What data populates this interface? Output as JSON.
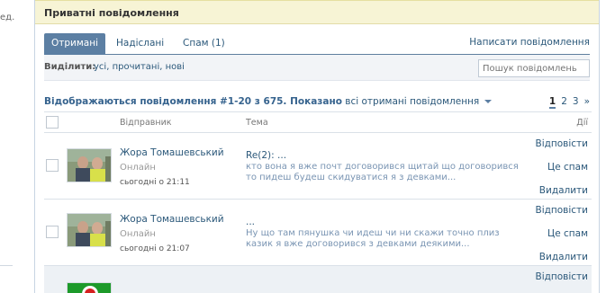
{
  "left_fragment": "ед.",
  "title": "Приватні повідомлення",
  "tabs": [
    "Отримані",
    "Надіслані",
    "Спам (1)"
  ],
  "compose_label": "Написати повідомлення",
  "filter": {
    "label": "Виділити:",
    "links": [
      "усі",
      "прочитані",
      "нові"
    ],
    "search_placeholder": "Пошук повідомлень"
  },
  "summary": {
    "text": "Відображаються повідомлення #1-20 з 675. Показано",
    "dropdown": "всі отримані повідомлення"
  },
  "pager": [
    "1",
    "2",
    "3",
    "»"
  ],
  "columns": {
    "sender": "Відправник",
    "subject": "Тема",
    "actions": "Дії"
  },
  "messages": [
    {
      "sender": "Жора Томашевський",
      "status": "Онлайн",
      "date": "сьогодні о 21:11",
      "subject": "Re(2): ...",
      "preview": "кто вона я вже почт договорився щитай що договорився то пидеш будеш скидуватися я з девками...",
      "actions": [
        "Відповісти",
        "Це спам",
        "Видалити"
      ]
    },
    {
      "sender": "Жора Томашевський",
      "status": "Онлайн",
      "date": "сьогодні о 21:07",
      "subject": "...",
      "preview": "Ну що там пянушка чи идеш чи ни скажи точно плиз казик я вже договорився з девками деякими...",
      "actions": [
        "Відповісти",
        "Це спам",
        "Видалити"
      ]
    },
    {
      "sender": "",
      "status": "",
      "date": "",
      "subject": "",
      "preview": "",
      "actions": [
        "Відповісти"
      ]
    }
  ]
}
